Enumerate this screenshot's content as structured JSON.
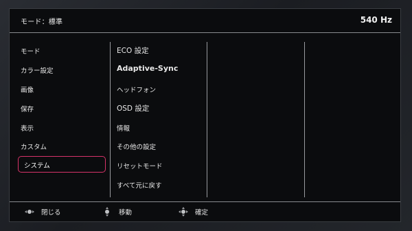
{
  "header": {
    "mode_title": "モード：標準",
    "refresh_rate": "540 Hz"
  },
  "main_menu": {
    "items": [
      {
        "label": "モード"
      },
      {
        "label": "カラー設定"
      },
      {
        "label": "画像"
      },
      {
        "label": "保存"
      },
      {
        "label": "表示"
      },
      {
        "label": "カスタム"
      },
      {
        "label": "システム",
        "selected": true
      }
    ]
  },
  "sub_menu": {
    "items": [
      {
        "label": "ECO 設定"
      },
      {
        "label": "Adaptive-Sync"
      },
      {
        "label": "ヘッドフォン"
      },
      {
        "label": "OSD 設定"
      },
      {
        "label": "情報"
      },
      {
        "label": "その他の設定"
      },
      {
        "label": "リセットモード"
      },
      {
        "label": "すべて元に戻す"
      }
    ]
  },
  "footer": {
    "hints": [
      {
        "icon": "joystick-left-right-icon",
        "label": "閉じる"
      },
      {
        "icon": "joystick-up-down-icon",
        "label": "移動"
      },
      {
        "icon": "joystick-press-icon",
        "label": "確定"
      }
    ]
  },
  "colors": {
    "accent": "#d8336a",
    "panel": "#0b0c0e",
    "text": "#e8e8e8"
  }
}
